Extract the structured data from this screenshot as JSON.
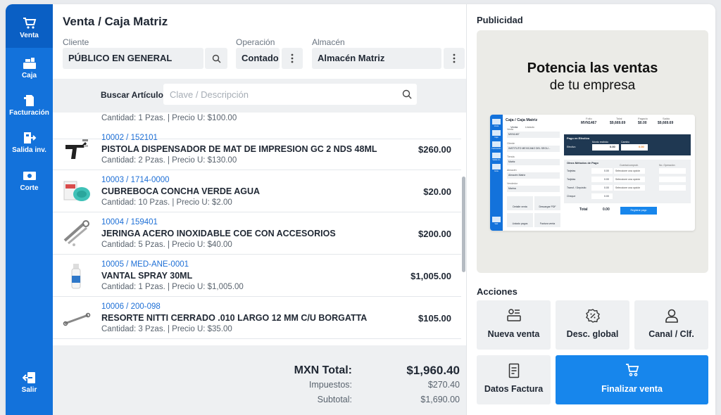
{
  "sidebar": {
    "items": [
      {
        "label": "Venta",
        "icon": "cart-icon"
      },
      {
        "label": "Caja",
        "icon": "cash-register-icon"
      },
      {
        "label": "Facturación",
        "icon": "invoice-icon"
      },
      {
        "label": "Salida inv.",
        "icon": "inventory-out-icon"
      },
      {
        "label": "Corte",
        "icon": "cash-cut-icon"
      }
    ],
    "logout_label": "Salir"
  },
  "header": {
    "title": "Venta / Caja Matriz",
    "cliente_label": "Cliente",
    "cliente_value": "PÚBLICO EN GENERAL",
    "operacion_label": "Operación",
    "operacion_value": "Contado",
    "almacen_label": "Almacén",
    "almacen_value": "Almacén Matriz"
  },
  "search": {
    "label": "Buscar Artículo:",
    "placeholder": "Clave / Descripción"
  },
  "items": [
    {
      "meta": "Cantidad: 1 Pzas. | Precio U: $100.00"
    },
    {
      "code": "10002  /  152101",
      "name": "PISTOLA DISPENSADOR DE MAT DE IMPRESION GC 2 NDS 48ML",
      "meta": "Cantidad: 2 Pzas.  |  Precio U: $130.00",
      "price": "$260.00"
    },
    {
      "code": "10003  /  1714-0000",
      "name": "CUBREBOCA CONCHA VERDE AGUA",
      "meta": "Cantidad: 10 Pzas.  |  Precio U: $2.00",
      "price": "$20.00"
    },
    {
      "code": "10004  /  159401",
      "name": "JERINGA ACERO INOXIDABLE COE CON ACCESORIOS",
      "meta": "Cantidad: 5 Pzas.  |  Precio U: $40.00",
      "price": "$200.00"
    },
    {
      "code": "10005  /  MED-ANE-0001",
      "name": "VANTAL SPRAY 30ML",
      "meta": "Cantidad: 1 Pzas.  |  Precio U: $1,005.00",
      "price": "$1,005.00"
    },
    {
      "code": "10006  /  200-098",
      "name": "RESORTE NITTI CERRADO .010 LARGO 12 MM C/U BORGATTA",
      "meta": "Cantidad: 3 Pzas.  |  Precio U: $35.00",
      "price": "$105.00"
    }
  ],
  "totals": {
    "total_label": "MXN Total:",
    "total_value": "$1,960.40",
    "taxes_label": "Impuestos:",
    "taxes_value": "$270.40",
    "subtotal_label": "Subtotal:",
    "subtotal_value": "$1,690.00"
  },
  "ad": {
    "section_title": "Publicidad",
    "headline_1": "Potencia las ventas",
    "headline_2": "de tu empresa",
    "mock": {
      "title": "Caja / Caja Matriz",
      "tabs": [
        "Venta",
        "Listado"
      ],
      "folio_label": "Folio",
      "folio_value": "MVN1467",
      "total_label": "Total",
      "total_value": "$9,669.69",
      "pagado_label": "Pagado",
      "pagado_value": "$0.00",
      "saldo_label": "Saldo",
      "saldo_value": "$9,669.69",
      "venta_label": "Venta",
      "venta_value": "MVN1467",
      "cliente_label": "Cliente",
      "cliente_value": "INSTITUTO MEXICANO DEL SEGU...",
      "tienda_label": "Tienda",
      "tienda_value": "Matriz",
      "almacen_label": "Almacén",
      "almacen_value": "Almacén Matriz",
      "vendedor_label": "Vendedor",
      "vendedor_value": "Marina",
      "pago_title": "Pago en Efectivo",
      "efectivo_label": "Efectivo",
      "monto_label": "Monto recibido",
      "monto_value": "0.00",
      "cambio_label": "Cambio",
      "cambio_value": "0.00",
      "otros_title": "Otros Métodos de Pago",
      "comprobante_label": "Cuenta/comprob.",
      "operacion_label": "No. Operación",
      "methods": [
        "Tarjetas",
        "Tarjetas",
        "Transf. / Depósito",
        "Cheque"
      ],
      "select_placeholder": "Seleccione una opción",
      "amount": "0.00",
      "buttons": [
        "Detalle venta",
        "Descargar PDF",
        "Listado pagos",
        "Factura venta"
      ],
      "total_row_label": "Total",
      "total_row_value": "0.00",
      "register_label": "Registrar pago",
      "sidebar_labels": [
        "Venta",
        "Caja",
        "Facturación",
        "Salida inv.",
        "Corte",
        "Salir"
      ]
    }
  },
  "actions": {
    "section_title": "Acciones",
    "buttons": [
      {
        "label": "Nueva venta",
        "icon": "new-sale-icon"
      },
      {
        "label": "Desc. global",
        "icon": "discount-badge-icon"
      },
      {
        "label": "Canal / Clf.",
        "icon": "user-icon"
      },
      {
        "label": "Datos Factura",
        "icon": "document-icon"
      },
      {
        "label": "Finalizar venta",
        "icon": "cart-icon"
      }
    ]
  },
  "colors": {
    "brand": "#1372db",
    "accent": "#1786ec",
    "panel": "#eef0f2",
    "code_link": "#1d6fd6"
  }
}
